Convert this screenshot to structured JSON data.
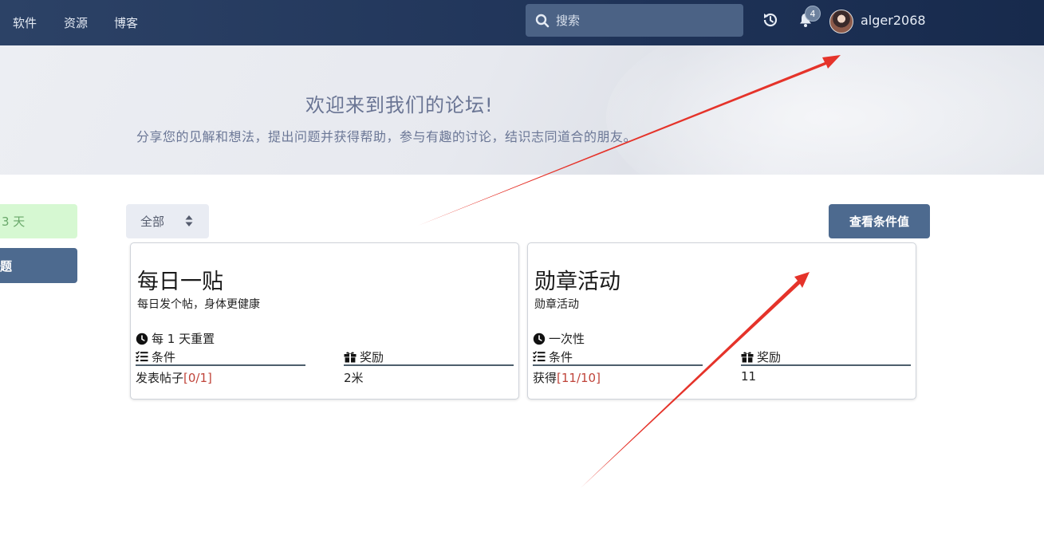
{
  "nav": {
    "items": [
      {
        "label": "软件"
      },
      {
        "label": "资源"
      },
      {
        "label": "博客"
      }
    ]
  },
  "search": {
    "placeholder": "搜索"
  },
  "header": {
    "notification_count": "4",
    "username": "alger2068"
  },
  "hero": {
    "title": "欢迎来到我们的论坛!",
    "subtitle": "分享您的见解和想法，提出问题并获得帮助，参与有趣的讨论，结识志同道合的朋友。"
  },
  "sidebar": {
    "streak_label": "3 天",
    "new_topic_label": "题"
  },
  "toolbar": {
    "filter_label": "全部",
    "view_conditions_label": "查看条件值"
  },
  "cards": [
    {
      "title": "每日一贴",
      "description": "每日发个帖，身体更健康",
      "reset": "每 1 天重置",
      "condition_header": "条件",
      "reward_header": "奖励",
      "condition_text": "发表帖子",
      "condition_progress": "[0/1]",
      "reward_value": "2米"
    },
    {
      "title": "勋章活动",
      "description": "勋章活动",
      "reset": "一次性",
      "condition_header": "条件",
      "reward_header": "奖励",
      "condition_text": "获得",
      "condition_progress": "[11/10]",
      "reward_value": "11"
    }
  ],
  "icons": {
    "search": "search-icon",
    "history": "history-icon",
    "bell": "bell-icon",
    "clock": "clock-icon",
    "list": "list-check-icon",
    "gift": "gift-icon",
    "sort": "sort-arrows-icon"
  },
  "colors": {
    "topbar": "#1f3358",
    "accent_button": "#4d6a8f",
    "progress_red": "#c0443a",
    "streak_bg": "#d6f8d2",
    "annotation_arrow": "#e5332a"
  }
}
